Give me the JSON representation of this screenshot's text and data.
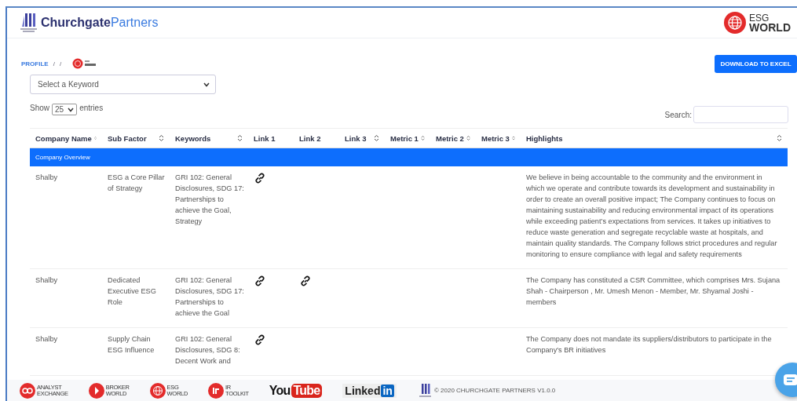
{
  "header": {
    "brand_part_1": "Churchgate",
    "brand_part_2": "Partners",
    "partner_logo": {
      "line_1": "ESG",
      "line_2": "WORLD"
    }
  },
  "breadcrumb": {
    "items": [
      "PROFILE",
      "/",
      "/"
    ]
  },
  "download_button": "DOWNLOAD TO EXCEL",
  "keyword_select": {
    "placeholder": "Select a Keyword"
  },
  "entries": {
    "prefix": "Show",
    "value": "25",
    "suffix": "entries"
  },
  "search": {
    "label": "Search:"
  },
  "table": {
    "columns": [
      {
        "label": "Company Name",
        "sortable": true
      },
      {
        "label": "Sub Factor",
        "sortable": true
      },
      {
        "label": "Keywords",
        "sortable": true
      },
      {
        "label": "Link 1",
        "sortable": false
      },
      {
        "label": "Link 2",
        "sortable": false
      },
      {
        "label": "Link 3",
        "sortable": true
      },
      {
        "label": "Metric 1",
        "sortable": true
      },
      {
        "label": "Metric 2",
        "sortable": true
      },
      {
        "label": "Metric 3",
        "sortable": true
      },
      {
        "label": "Highlights",
        "sortable": true
      }
    ],
    "group": "Company Overview",
    "rows": [
      {
        "company": "Shalby",
        "sub_factor": "ESG a Core Pillar of Strategy",
        "keywords": "GRI 102: General Disclosures, SDG 17: Partnerships to achieve the Goal, Strategy",
        "links": [
          true,
          false,
          false
        ],
        "highlights": "We believe in being accountable to the community and the environment in which we operate and contribute towards its development and sustainability in order to create an overall positive impact; The Company continues to focus on maintaining sustainability and reducing environmental impact of its operations while exceeding patient’s expectations from services. It takes up initiatives to reduce waste generation and segregate recyclable waste at hospitals, and maintain quality standards. The Company follows strict procedures and regular monitoring to ensure compliance with legal and safety requirements"
      },
      {
        "company": "Shalby",
        "sub_factor": "Dedicated Executive ESG Role",
        "keywords": "GRI 102: General Disclosures, SDG 17: Partnerships to achieve the Goal",
        "links": [
          true,
          true,
          false
        ],
        "highlights": "The Company has constituted a CSR Committee, which comprises Mrs. Sujana Shah - Chairperson , Mr. Umesh Menon - Member, Mr. Shyamal Joshi - members"
      },
      {
        "company": "Shalby",
        "sub_factor": "Supply Chain ESG Influence",
        "keywords": "GRI 102: General Disclosures, SDG 8: Decent Work and",
        "links": [
          true,
          false,
          false
        ],
        "highlights": "The Company does not mandate its suppliers/distributors to participate in the Company's BR initiatives"
      }
    ]
  },
  "footer": {
    "logos": [
      {
        "kind": "analyst",
        "line_1": "ANALYST",
        "line_2": "EXCHANGE"
      },
      {
        "kind": "broker",
        "line_1": "BROKER",
        "line_2": "WORLD"
      },
      {
        "kind": "esg",
        "line_1": "ESG",
        "line_2": "WORLD"
      },
      {
        "kind": "ir",
        "line_1": "IR",
        "line_2": "TOOLKIT"
      }
    ],
    "youtube": {
      "part_1": "You",
      "part_2": "Tube"
    },
    "linkedin": {
      "part_1": "Linked",
      "part_2": "in"
    },
    "copyright": "© 2020 CHURCHGATE PARTNERS V1.0.0"
  }
}
